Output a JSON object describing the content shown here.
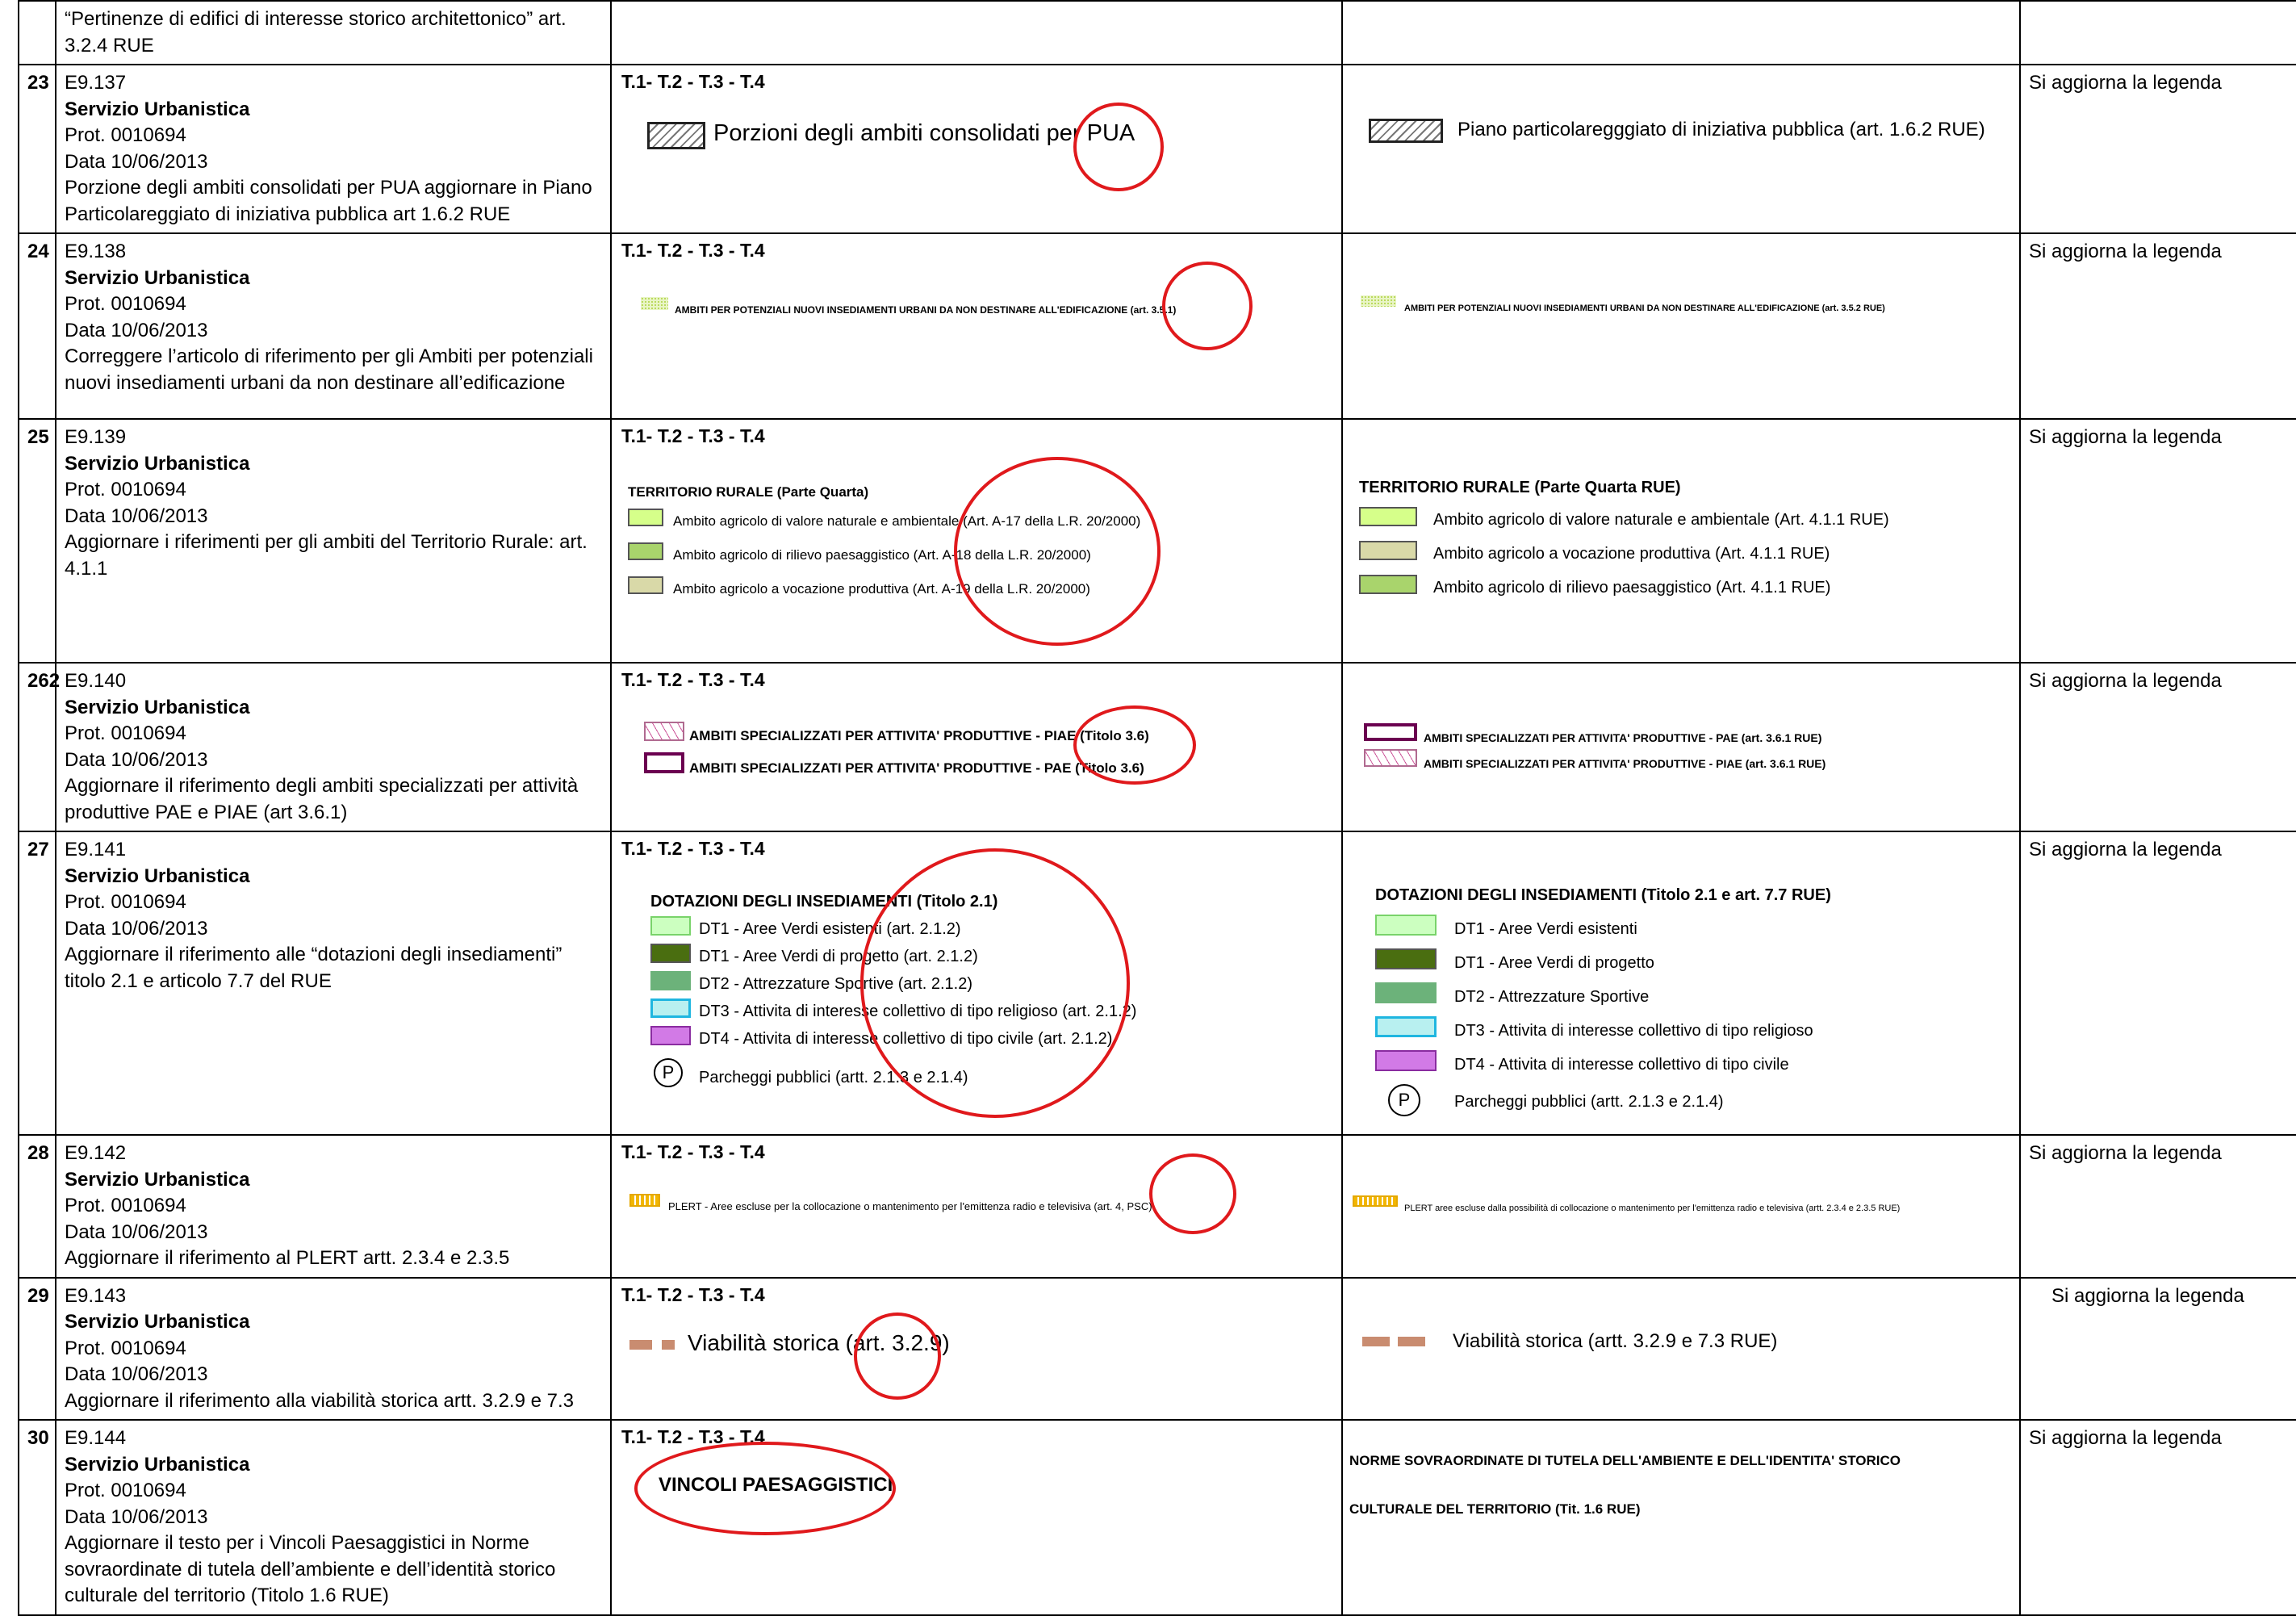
{
  "top_row": {
    "desc": "“Pertinenze di edifici di interesse storico architettonico” art. 3.2.4 RUE"
  },
  "rows": [
    {
      "num": "23",
      "code": "E9.137",
      "office": "Servizio Urbanistica",
      "prot": "Prot. 0010694",
      "date": "Data 10/06/2013",
      "text": "Porzione degli ambiti consolidati per PUA aggiornare in Piano Particolareggiato di iniziativa pubblica art 1.6.2 RUE",
      "tables": "T.1- T.2 - T.3 - T.4",
      "before": "Porzioni degli ambiti consolidati per PUA",
      "after": "Piano particolaregggiato di iniziativa pubblica (art. 1.6.2 RUE)",
      "note": "Si aggiorna la legenda"
    },
    {
      "num": "24",
      "code": "E9.138",
      "office": "Servizio Urbanistica",
      "prot": "Prot. 0010694",
      "date": "Data 10/06/2013",
      "text": "Correggere l’articolo di riferimento per gli Ambiti per potenziali nuovi insediamenti urbani da non destinare all’edificazione",
      "tables": "T.1- T.2 - T.3 - T.4",
      "before": "AMBITI PER POTENZIALI NUOVI INSEDIAMENTI URBANI DA NON DESTINARE ALL'EDIFICAZIONE (art. 3.5.1)",
      "after": "AMBITI PER POTENZIALI NUOVI INSEDIAMENTI URBANI DA NON DESTINARE ALL'EDIFICAZIONE (art. 3.5.2 RUE)",
      "note": "Si aggiorna la legenda"
    },
    {
      "num": "25",
      "code": "E9.139",
      "office": "Servizio Urbanistica",
      "prot": "Prot. 0010694",
      "date": "Data 10/06/2013",
      "text": "Aggiornare i riferimenti per gli ambiti del Territorio Rurale: art. 4.1.1",
      "tables": "T.1- T.2 - T.3 - T.4",
      "before_title": "TERRITORIO RURALE (Parte Quarta)",
      "before_items": [
        "Ambito agricolo di valore naturale e ambientale (Art. A-17 della L.R. 20/2000)",
        "Ambito agricolo di rilievo paesaggistico (Art. A-18 della L.R. 20/2000)",
        "Ambito agricolo a vocazione produttiva (Art. A-19 della L.R. 20/2000)"
      ],
      "after_title": "TERRITORIO RURALE (Parte Quarta RUE)",
      "after_items": [
        "Ambito agricolo di valore naturale e ambientale (Art. 4.1.1 RUE)",
        "Ambito agricolo a vocazione produttiva (Art. 4.1.1 RUE)",
        "Ambito agricolo di rilievo paesaggistico (Art. 4.1.1 RUE)"
      ],
      "note": "Si aggiorna la legenda"
    },
    {
      "num": "262",
      "code": "E9.140",
      "office": "Servizio Urbanistica",
      "prot": "Prot. 0010694",
      "date": "Data 10/06/2013",
      "text": "Aggiornare il riferimento degli ambiti specializzati per attività produttive PAE e PIAE (art 3.6.1)",
      "tables": "T.1- T.2 - T.3 - T.4",
      "before_items": [
        "AMBITI SPECIALIZZATI PER ATTIVITA' PRODUTTIVE - PIAE (Titolo 3.6)",
        "AMBITI SPECIALIZZATI PER ATTIVITA' PRODUTTIVE - PAE (Titolo 3.6)"
      ],
      "after_items": [
        "AMBITI SPECIALIZZATI PER ATTIVITA' PRODUTTIVE - PAE (art. 3.6.1 RUE)",
        "AMBITI SPECIALIZZATI PER ATTIVITA' PRODUTTIVE - PIAE (art. 3.6.1 RUE)"
      ],
      "note": "Si aggiorna la legenda"
    },
    {
      "num": "27",
      "code": "E9.141",
      "office": "Servizio Urbanistica",
      "prot": "Prot. 0010694",
      "date": "Data 10/06/2013",
      "text": "Aggiornare il riferimento alle “dotazioni degli insediamenti” titolo 2.1 e articolo 7.7 del RUE",
      "tables": "T.1- T.2 - T.3 - T.4",
      "before_title": "DOTAZIONI DEGLI INSEDIAMENTI (Titolo 2.1)",
      "before_items": [
        "DT1 - Aree Verdi esistenti (art. 2.1.2)",
        "DT1 - Aree Verdi di progetto (art. 2.1.2)",
        "DT2 - Attrezzature Sportive (art. 2.1.2)",
        "DT3 - Attivita di interesse collettivo di tipo religioso (art. 2.1.2)",
        "DT4 - Attivita di interesse collettivo di tipo civile (art. 2.1.2)"
      ],
      "before_parking": "Parcheggi pubblici (artt. 2.1.3 e 2.1.4)",
      "after_title": "DOTAZIONI DEGLI INSEDIAMENTI (Titolo 2.1 e art. 7.7 RUE)",
      "after_items": [
        "DT1 - Aree Verdi esistenti",
        "DT1 - Aree Verdi di progetto",
        "DT2 - Attrezzature Sportive",
        "DT3 - Attivita di interesse collettivo di tipo religioso",
        "DT4 - Attivita di interesse collettivo di tipo civile"
      ],
      "after_parking": "Parcheggi pubblici (artt. 2.1.3 e 2.1.4)",
      "parking_symbol": "P",
      "note": "Si aggiorna la legenda"
    },
    {
      "num": "28",
      "code": "E9.142",
      "office": "Servizio Urbanistica",
      "prot": "Prot. 0010694",
      "date": "Data 10/06/2013",
      "text": "Aggiornare il riferimento al PLERT artt. 2.3.4 e 2.3.5",
      "tables": "T.1- T.2 - T.3 - T.4",
      "before": "PLERT - Aree escluse per la collocazione o mantenimento per l'emittenza radio e televisiva (art. 4, PSC)",
      "after": "PLERT aree escluse dalla possibilità di collocazione o mantenimento per l'emittenza radio e televisiva (artt. 2.3.4 e 2.3.5 RUE)",
      "note": "Si aggiorna la legenda"
    },
    {
      "num": "29",
      "code": "E9.143",
      "office": "Servizio Urbanistica",
      "prot": "Prot. 0010694",
      "date": "Data 10/06/2013",
      "text": "Aggiornare il riferimento alla viabilità storica artt. 3.2.9 e 7.3",
      "tables": "T.1- T.2 - T.3 - T.4",
      "before": "Viabilità storica (art. 3.2.9)",
      "after": "Viabilità storica (artt. 3.2.9 e 7.3 RUE)",
      "note": "Si aggiorna la legenda"
    },
    {
      "num": "30",
      "code": "E9.144",
      "office": "Servizio Urbanistica",
      "prot": "Prot. 0010694",
      "date": "Data 10/06/2013",
      "text": "Aggiornare il testo per i Vincoli Paesaggistici in Norme sovraordinate di tutela dell’ambiente e dell’identità storico culturale del territorio (Titolo 1.6 RUE)",
      "tables": "T.1- T.2 - T.3 - T.4",
      "before": "VINCOLI PAESAGGISTICI",
      "after_line1": "NORME SOVRAORDINATE DI TUTELA DELL'AMBIENTE E DELL'IDENTITA' STORICO",
      "after_line2": "CULTURALE DEL TERRITORIO (Tit. 1.6 RUE)",
      "note": "Si aggiorna la legenda"
    }
  ],
  "colors": {
    "annotation_red": "#e0191c",
    "rural_valore": "#d6ff8a",
    "rural_rilievo": "#a9d46c",
    "rural_produttiva": "#d9d9a8",
    "dt1_esistenti": "#ccffc0",
    "dt1_progetto": "#4a6e10",
    "dt2": "#6cb27a",
    "dt3": "#b8f0f0",
    "dt4": "#d27ae6",
    "viabilita": "#c98c70"
  }
}
